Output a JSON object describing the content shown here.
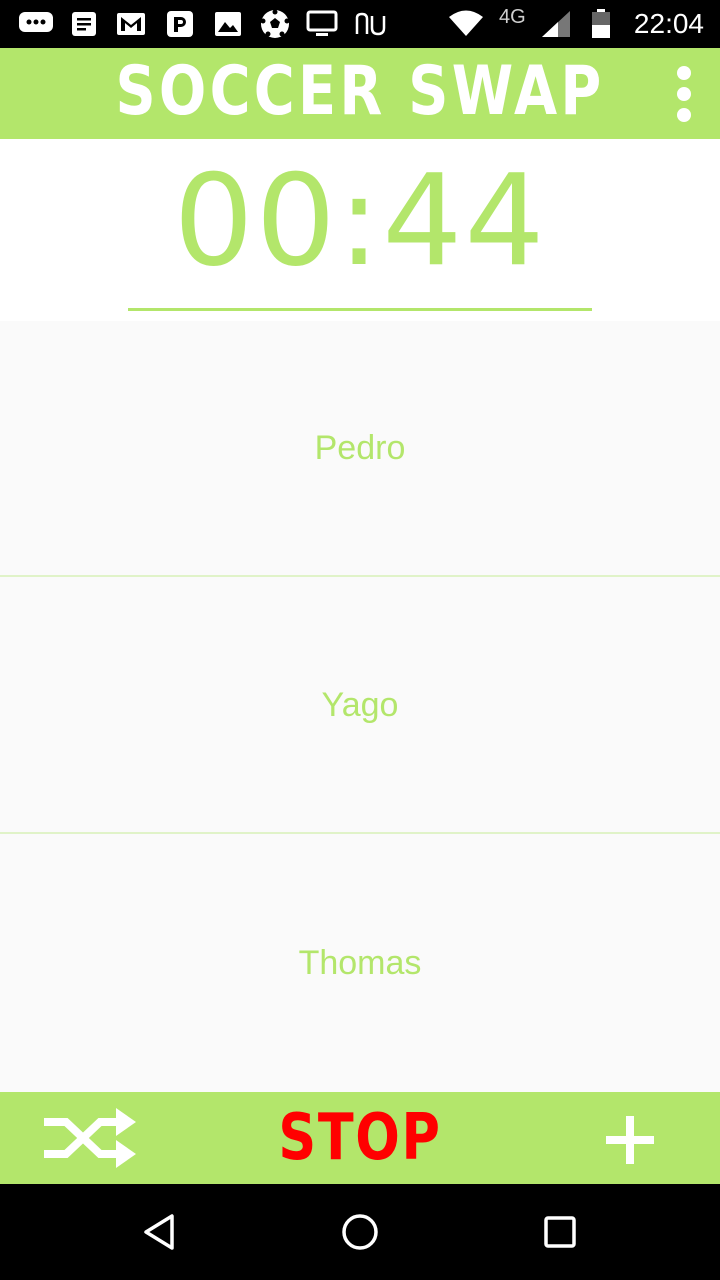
{
  "status_bar": {
    "notification_icons": [
      "chat-bubble-icon",
      "message-icon",
      "gmail-icon",
      "parking-app-icon",
      "image-icon",
      "soccer-ball-icon",
      "tv-icon",
      "nu-app-icon"
    ],
    "network_label": "4G",
    "clock": "22:04",
    "system_icons": [
      "wifi-icon",
      "signal-icon",
      "battery-icon"
    ]
  },
  "app_bar": {
    "title": "SOCCER SWAP",
    "overflow_icon": "more-vert-icon"
  },
  "timer": {
    "value": "00:44"
  },
  "players": [
    {
      "name": "Pedro"
    },
    {
      "name": "Yago"
    },
    {
      "name": "Thomas"
    }
  ],
  "bottom_bar": {
    "shuffle_icon": "shuffle-icon",
    "stop_label": "STOP",
    "add_icon": "plus-icon"
  },
  "nav_bar": {
    "buttons": [
      "back-icon",
      "home-icon",
      "recents-icon"
    ]
  },
  "colors": {
    "accent": "#b3e66b",
    "stop": "#ff0000",
    "list_bg": "#fafafa",
    "divider": "#e0f3c8"
  }
}
